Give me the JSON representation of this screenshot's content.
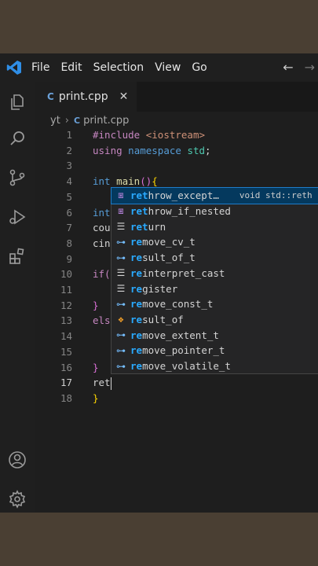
{
  "menubar": {
    "items": [
      "File",
      "Edit",
      "Selection",
      "View",
      "Go"
    ],
    "back_arrow": "←",
    "forward_arrow": "→"
  },
  "tab": {
    "icon": "C",
    "name": "print.cpp",
    "close": "✕"
  },
  "breadcrumb": {
    "folder": "yt",
    "sep": "›",
    "icon": "C",
    "file": "print.cpp"
  },
  "editor": {
    "line_numbers": [
      "1",
      "2",
      "3",
      "4",
      "5",
      "6",
      "7",
      "8",
      "9",
      "10",
      "11",
      "12",
      "13",
      "14",
      "15",
      "16",
      "17",
      "18"
    ],
    "lines": [
      {
        "n": 1,
        "tokens": [
          {
            "t": "#include",
            "c": "pp"
          },
          {
            "t": " ",
            "c": ""
          },
          {
            "t": "<iostream>",
            "c": "inc"
          }
        ]
      },
      {
        "n": 2,
        "tokens": [
          {
            "t": "using",
            "c": "pp"
          },
          {
            "t": " ",
            "c": ""
          },
          {
            "t": "namespace",
            "c": "kw"
          },
          {
            "t": " ",
            "c": ""
          },
          {
            "t": "std",
            "c": "ty"
          },
          {
            "t": ";",
            "c": ""
          }
        ]
      },
      {
        "n": 3,
        "tokens": []
      },
      {
        "n": 4,
        "tokens": [
          {
            "t": "int",
            "c": "kw"
          },
          {
            "t": " ",
            "c": ""
          },
          {
            "t": "main",
            "c": "fn"
          },
          {
            "t": "()",
            "c": "br2"
          },
          {
            "t": "{",
            "c": "br"
          }
        ]
      },
      {
        "n": 5,
        "tokens": []
      },
      {
        "n": 6,
        "tokens": [
          {
            "t": "int",
            "c": "kw"
          }
        ]
      },
      {
        "n": 7,
        "tokens": [
          {
            "t": "cou",
            "c": ""
          }
        ]
      },
      {
        "n": 8,
        "tokens": [
          {
            "t": "cin",
            "c": ""
          }
        ]
      },
      {
        "n": 9,
        "tokens": []
      },
      {
        "n": 10,
        "tokens": [
          {
            "t": "if(",
            "c": "pp"
          }
        ]
      },
      {
        "n": 11,
        "tokens": []
      },
      {
        "n": 12,
        "tokens": [
          {
            "t": "}",
            "c": "br2"
          }
        ]
      },
      {
        "n": 13,
        "tokens": [
          {
            "t": "els",
            "c": "pp"
          }
        ]
      },
      {
        "n": 14,
        "tokens": []
      },
      {
        "n": 15,
        "tokens": []
      },
      {
        "n": 16,
        "tokens": [
          {
            "t": "}",
            "c": "br2"
          }
        ]
      },
      {
        "n": 17,
        "tokens": [
          {
            "t": "ret",
            "c": ""
          }
        ]
      },
      {
        "n": 18,
        "tokens": [
          {
            "t": "}",
            "c": "br"
          }
        ]
      }
    ],
    "current_line": 17
  },
  "suggestions": [
    {
      "icon": "⧆",
      "kind": "method",
      "match": "ret",
      "rest": "hrow_except…",
      "detail": "void std::reth",
      "selected": true
    },
    {
      "icon": "⧆",
      "kind": "method",
      "match": "ret",
      "rest": "hrow_if_nested",
      "detail": "",
      "selected": false
    },
    {
      "icon": "☰",
      "kind": "keyword",
      "match": "ret",
      "rest": "urn",
      "detail": "",
      "selected": false
    },
    {
      "icon": "⊶",
      "kind": "type",
      "match": "re",
      "rest": "move_cv_t",
      "detail": "",
      "selected": false
    },
    {
      "icon": "⊶",
      "kind": "type",
      "match": "re",
      "rest": "sult_of_t",
      "detail": "",
      "selected": false
    },
    {
      "icon": "☰",
      "kind": "keyword",
      "match": "re",
      "rest": "interpret_cast",
      "detail": "",
      "selected": false
    },
    {
      "icon": "☰",
      "kind": "keyword",
      "match": "re",
      "rest": "gister",
      "detail": "",
      "selected": false
    },
    {
      "icon": "⊶",
      "kind": "type",
      "match": "re",
      "rest": "move_const_t",
      "detail": "",
      "selected": false
    },
    {
      "icon": "❖",
      "kind": "struct",
      "match": "re",
      "rest": "sult_of",
      "detail": "",
      "selected": false
    },
    {
      "icon": "⊶",
      "kind": "type",
      "match": "re",
      "rest": "move_extent_t",
      "detail": "",
      "selected": false
    },
    {
      "icon": "⊶",
      "kind": "type",
      "match": "re",
      "rest": "move_pointer_t",
      "detail": "",
      "selected": false
    },
    {
      "icon": "⊶",
      "kind": "type",
      "match": "re",
      "rest": "move_volatile_t",
      "detail": "",
      "selected": false
    }
  ],
  "colors": {
    "editor_bg": "#1e1e1e",
    "sidebar_bg": "#1f1f1f",
    "accent": "#1f7dc9",
    "frame_bg": "#4a3f33"
  }
}
